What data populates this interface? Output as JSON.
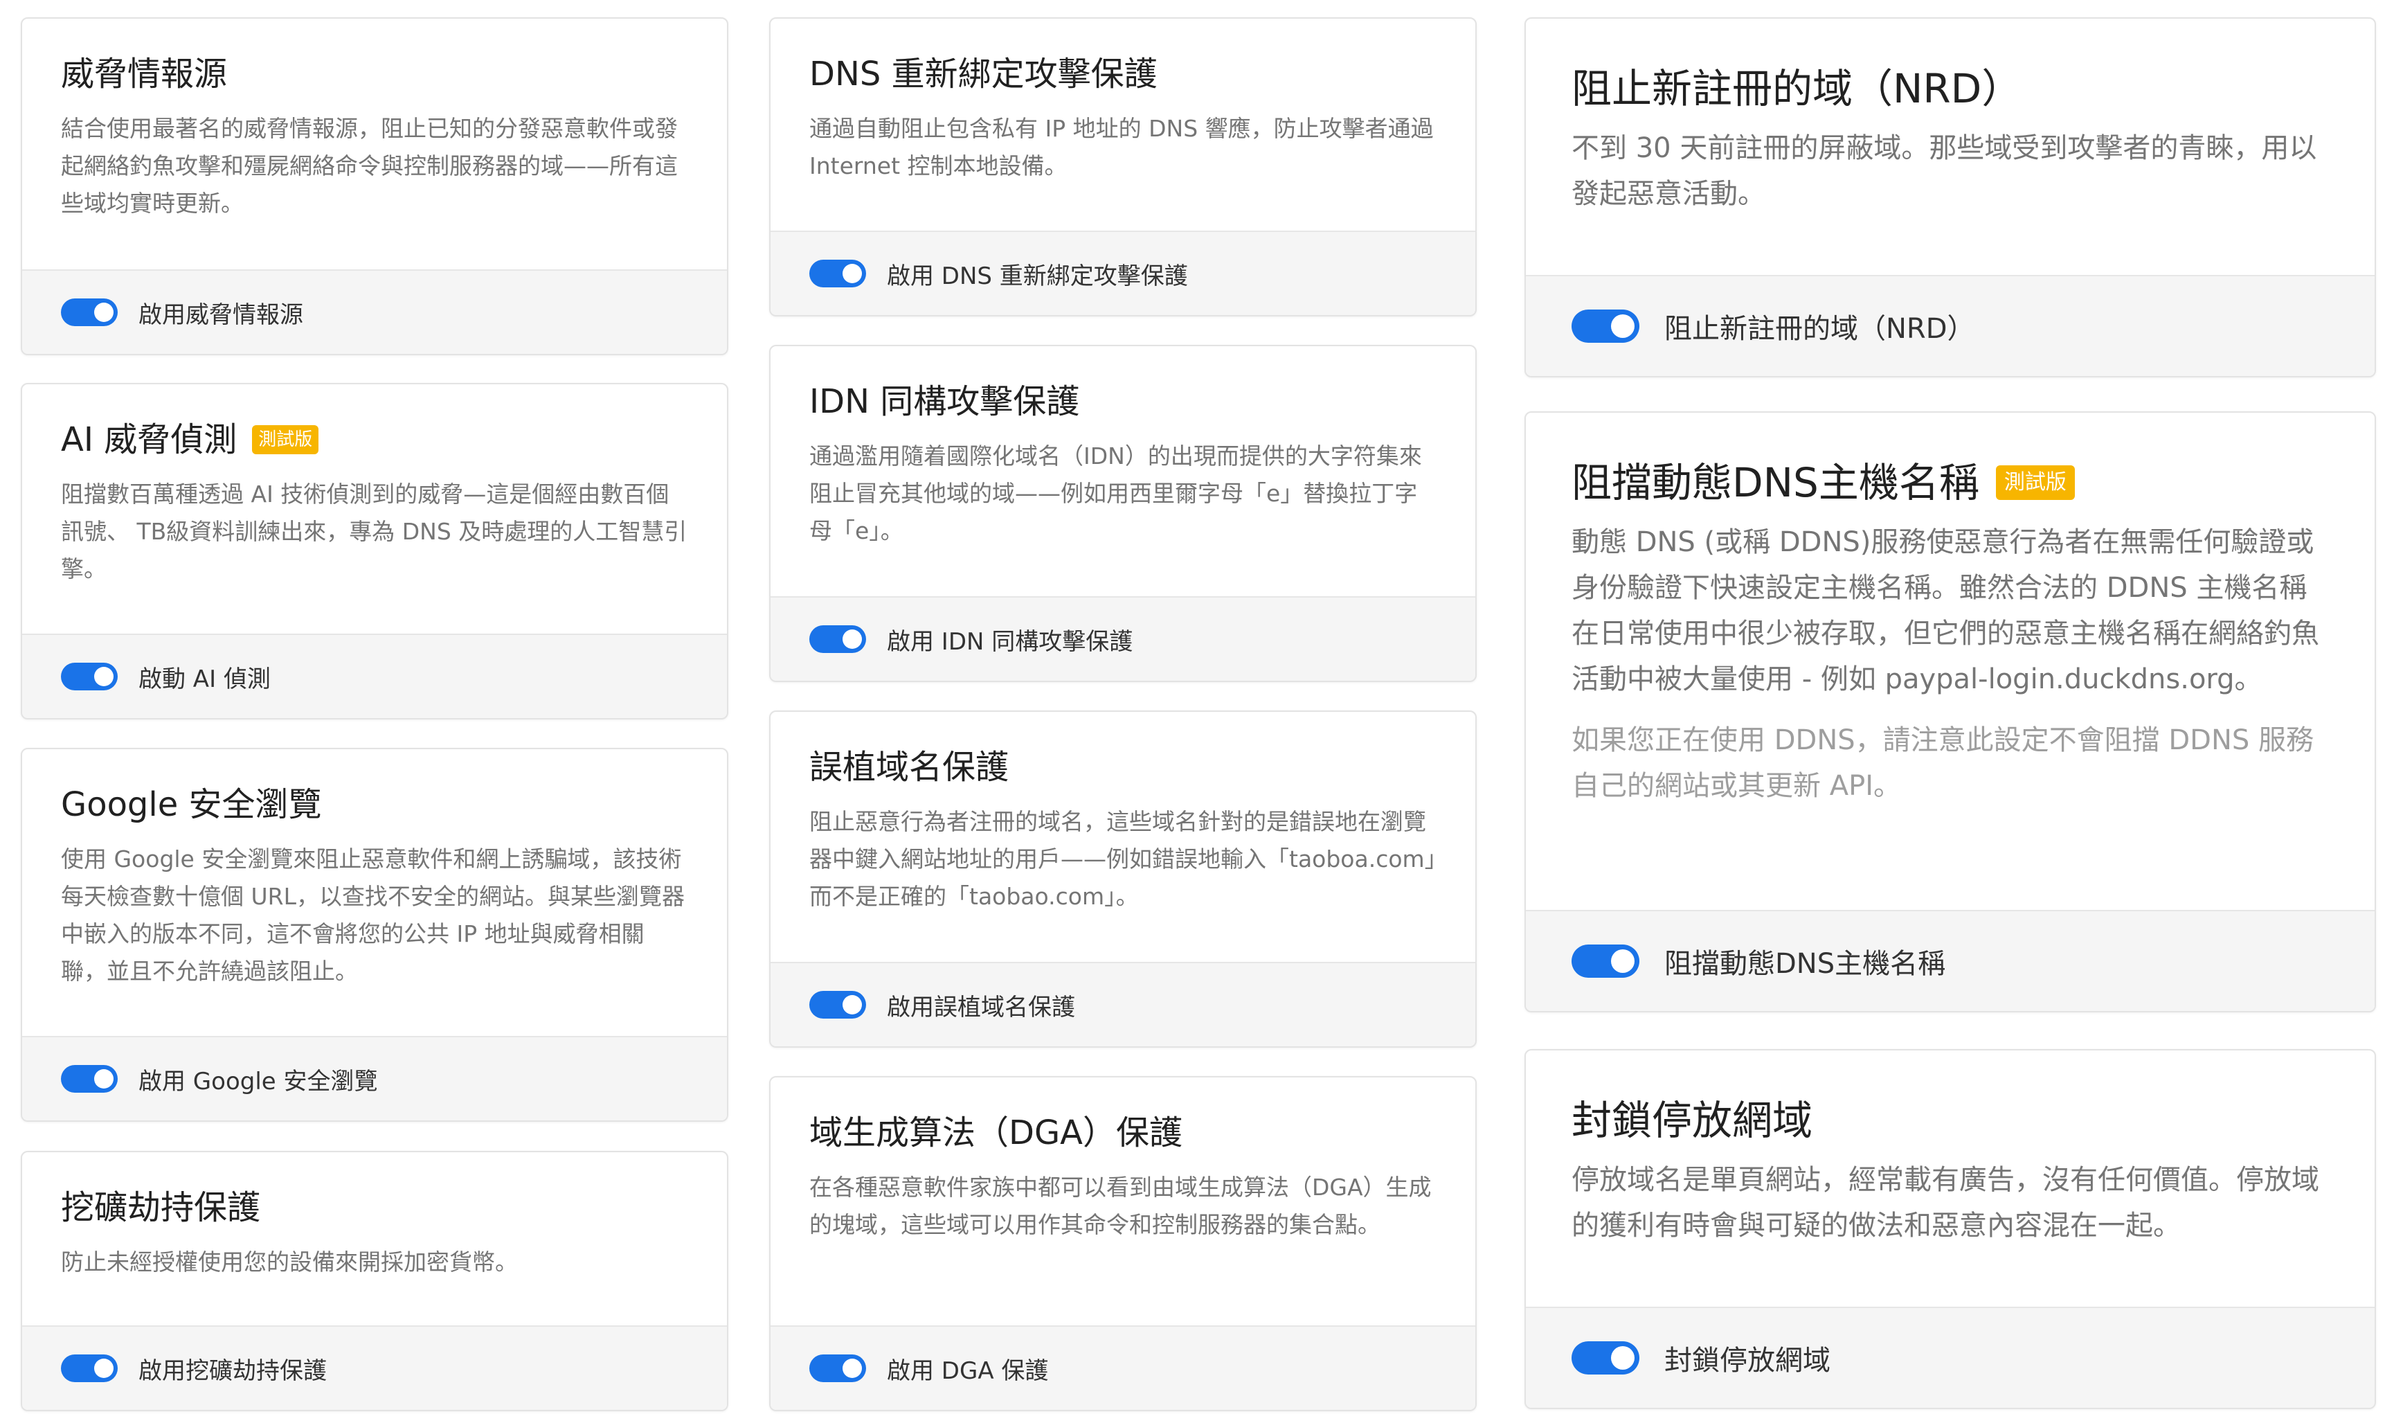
{
  "colors": {
    "toggle_on": "#1a73e8",
    "beta_badge": "#f7b500",
    "footer_bg": "#f5f5f5",
    "title": "#212121",
    "description": "#757575"
  },
  "columns": [
    {
      "cards": [
        {
          "title": "威脅情報源",
          "description": "結合使用最著名的威脅情報源，阻止已知的分發惡意軟件或發起網絡釣魚攻擊和殭屍網絡命令與控制服務器的域——所有這些域均實時更新。",
          "toggle_label": "啟用威脅情報源",
          "enabled": true
        },
        {
          "title": "AI 威脅偵測",
          "badge": "測試版",
          "description": "阻擋數百萬種透過 AI 技術偵測到的威脅—這是個經由數百個訊號、 TB級資料訓練出來，專為 DNS 及時處理的人工智慧引擎。",
          "toggle_label": "啟動 AI 偵測",
          "enabled": true
        },
        {
          "title": "Google 安全瀏覽",
          "description": "使用 Google 安全瀏覽來阻止惡意軟件和網上誘騙域，該技術每天檢查數十億個 URL，以查找不安全的網站。與某些瀏覽器中嵌入的版本不同，這不會將您的公共 IP 地址與威脅相關聯，並且不允許繞過該阻止。",
          "toggle_label": "啟用 Google 安全瀏覽",
          "enabled": true
        },
        {
          "title": "挖礦劫持保護",
          "description": "防止未經授權使用您的設備來開採加密貨幣。",
          "toggle_label": "啟用挖礦劫持保護",
          "enabled": true
        }
      ]
    },
    {
      "cards": [
        {
          "title": "DNS 重新綁定攻擊保護",
          "description": "通過自動阻止包含私有 IP 地址的 DNS 響應，防止攻擊者通過 Internet 控制本地設備。",
          "toggle_label": "啟用 DNS 重新綁定攻擊保護",
          "enabled": true
        },
        {
          "title": "IDN 同構攻擊保護",
          "description": "通過濫用隨着國際化域名（IDN）的出現而提供的大字符集來阻止冒充其他域的域——例如用西里爾字母「е」替換拉丁字母「e」。",
          "toggle_label": "啟用 IDN 同構攻擊保護",
          "enabled": true
        },
        {
          "title": "誤植域名保護",
          "description": "阻止惡意行為者注冊的域名，這些域名針對的是錯誤地在瀏覽器中鍵入網站地址的用戶——例如錯誤地輸入「taoboa.com」而不是正確的「taobao.com」。",
          "toggle_label": "啟用誤植域名保護",
          "enabled": true
        },
        {
          "title": "域生成算法（DGA）保護",
          "description": "在各種惡意軟件家族中都可以看到由域生成算法（DGA）生成的塊域，這些域可以用作其命令和控制服務器的集合點。",
          "toggle_label": "啟用 DGA 保護",
          "enabled": true
        }
      ]
    },
    {
      "cards": [
        {
          "title": "阻止新註冊的域（NRD）",
          "description": "不到 30 天前註冊的屏蔽域。那些域受到攻擊者的青睞，用以發起惡意活動。",
          "toggle_label": "阻止新註冊的域（NRD）",
          "enabled": true
        },
        {
          "title": "阻擋動態DNS主機名稱",
          "badge": "測試版",
          "description": "動態 DNS (或稱 DDNS)服務使惡意行為者在無需任何驗證或身份驗證下快速設定主機名稱。雖然合法的 DDNS 主機名稱在日常使用中很少被存取，但它們的惡意主機名稱在網絡釣魚活動中被大量使用 - 例如 paypal-login.duckdns.org。",
          "note": "如果您正在使用 DDNS，請注意此設定不會阻擋 DDNS 服務自己的網站或其更新 API。",
          "toggle_label": "阻擋動態DNS主機名稱",
          "enabled": true
        },
        {
          "title": "封鎖停放網域",
          "description": "停放域名是單頁網站，經常載有廣告，沒有任何價值。停放域的獲利有時會與可疑的做法和惡意內容混在一起。",
          "toggle_label": "封鎖停放網域",
          "enabled": true
        }
      ]
    }
  ]
}
